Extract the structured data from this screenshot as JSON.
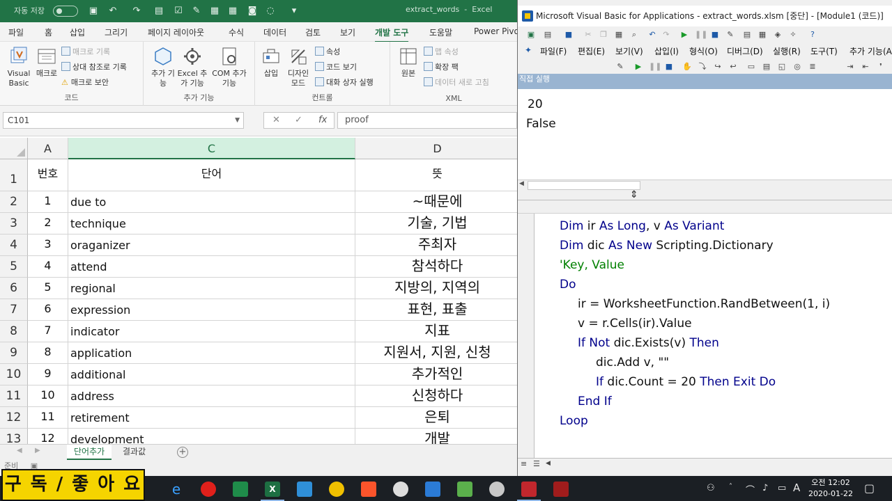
{
  "excel": {
    "titlebar": {
      "autosave_label": "자동 저장",
      "autosave_state": "끔",
      "filename": "extract_words",
      "app": "Excel"
    },
    "ribbon_tabs": [
      "파일",
      "홈",
      "삽입",
      "그리기",
      "페이지 레이아웃",
      "수식",
      "데이터",
      "검토",
      "보기",
      "개발 도구",
      "도움말",
      "Power Pivot"
    ],
    "active_tab": "개발 도구",
    "groups": {
      "code": {
        "label": "코드",
        "visual_basic": "Visual Basic",
        "macro": "매크로",
        "record_macro": "매크로 기록",
        "relative_ref": "상대 참조로 기록",
        "macro_security": "매크로 보안"
      },
      "addins": {
        "label": "추가 기능",
        "addins": "추가 기능",
        "excel_addins": "Excel 추가 기능",
        "com_addins": "COM 추가 기능"
      },
      "controls": {
        "label": "컨트롤",
        "insert": "삽입",
        "design_mode": "디자인 모드",
        "properties": "속성",
        "view_code": "코드 보기",
        "run_dialog": "대화 상자 실행"
      },
      "xml": {
        "label": "XML",
        "source": "원본",
        "map_properties": "맵 속성",
        "expansion_packs": "확장 팩",
        "refresh_data": "데이터 새로 고침"
      }
    },
    "formula_bar": {
      "name_box": "C101",
      "fx": "fx",
      "formula": "proof"
    },
    "columns": [
      "A",
      "C",
      "D"
    ],
    "header_row": {
      "row": "1",
      "num": "번호",
      "word": "단어",
      "meaning": "뜻"
    },
    "rows": [
      {
        "row": "2",
        "num": "1",
        "word": "due to",
        "meaning": "~때문에"
      },
      {
        "row": "3",
        "num": "2",
        "word": "technique",
        "meaning": "기술, 기법"
      },
      {
        "row": "4",
        "num": "3",
        "word": "oraganizer",
        "meaning": "주최자"
      },
      {
        "row": "5",
        "num": "4",
        "word": "attend",
        "meaning": "참석하다"
      },
      {
        "row": "6",
        "num": "5",
        "word": "regional",
        "meaning": "지방의, 지역의"
      },
      {
        "row": "7",
        "num": "6",
        "word": "expression",
        "meaning": "표현, 표출"
      },
      {
        "row": "8",
        "num": "7",
        "word": "indicator",
        "meaning": "지표"
      },
      {
        "row": "9",
        "num": "8",
        "word": "application",
        "meaning": "지원서, 지원, 신청"
      },
      {
        "row": "10",
        "num": "9",
        "word": "additional",
        "meaning": "추가적인"
      },
      {
        "row": "11",
        "num": "10",
        "word": "address",
        "meaning": "신청하다"
      },
      {
        "row": "12",
        "num": "11",
        "word": "retirement",
        "meaning": "은퇴"
      },
      {
        "row": "13",
        "num": "12",
        "word": "development",
        "meaning": "개발"
      }
    ],
    "sheet_tabs": [
      "단어추가",
      "결과값"
    ],
    "active_sheet": "단어추가",
    "status": "준비"
  },
  "vbe": {
    "title": "Microsoft Visual Basic for Applications - extract_words.xlsm [중단] - [Module1 (코드)]",
    "menus": [
      "파일(F)",
      "편집(E)",
      "보기(V)",
      "삽입(I)",
      "형식(O)",
      "디버그(D)",
      "실행(R)",
      "도구(T)",
      "추가 기능(A)"
    ],
    "immediate": {
      "title": "직접 실행",
      "lines": [
        " 20",
        "False"
      ]
    },
    "code_lines": [
      "Dim ir As Long, v As Variant",
      "Dim dic As New Scripting.Dictionary",
      "'Key, Value",
      "Do",
      "ir = WorksheetFunction.RandBetween(1, i)",
      "v = r.Cells(ir).Value",
      "If Not dic.Exists(v) Then",
      "dic.Add v, \"\"",
      "If dic.Count = 20 Then Exit Do",
      "End If",
      "Loop"
    ]
  },
  "overlay_text": "구 독 / 좋 아 요",
  "taskbar": {
    "time": "오전 12:02",
    "date": "2020-01-22",
    "ime": "A"
  },
  "colors": {
    "excel_green": "#217346",
    "vba_keyword": "#00008b",
    "vba_comment": "#008000",
    "immediate_titlebar": "#99b4d1",
    "overlay_bg": "#f5d400"
  }
}
